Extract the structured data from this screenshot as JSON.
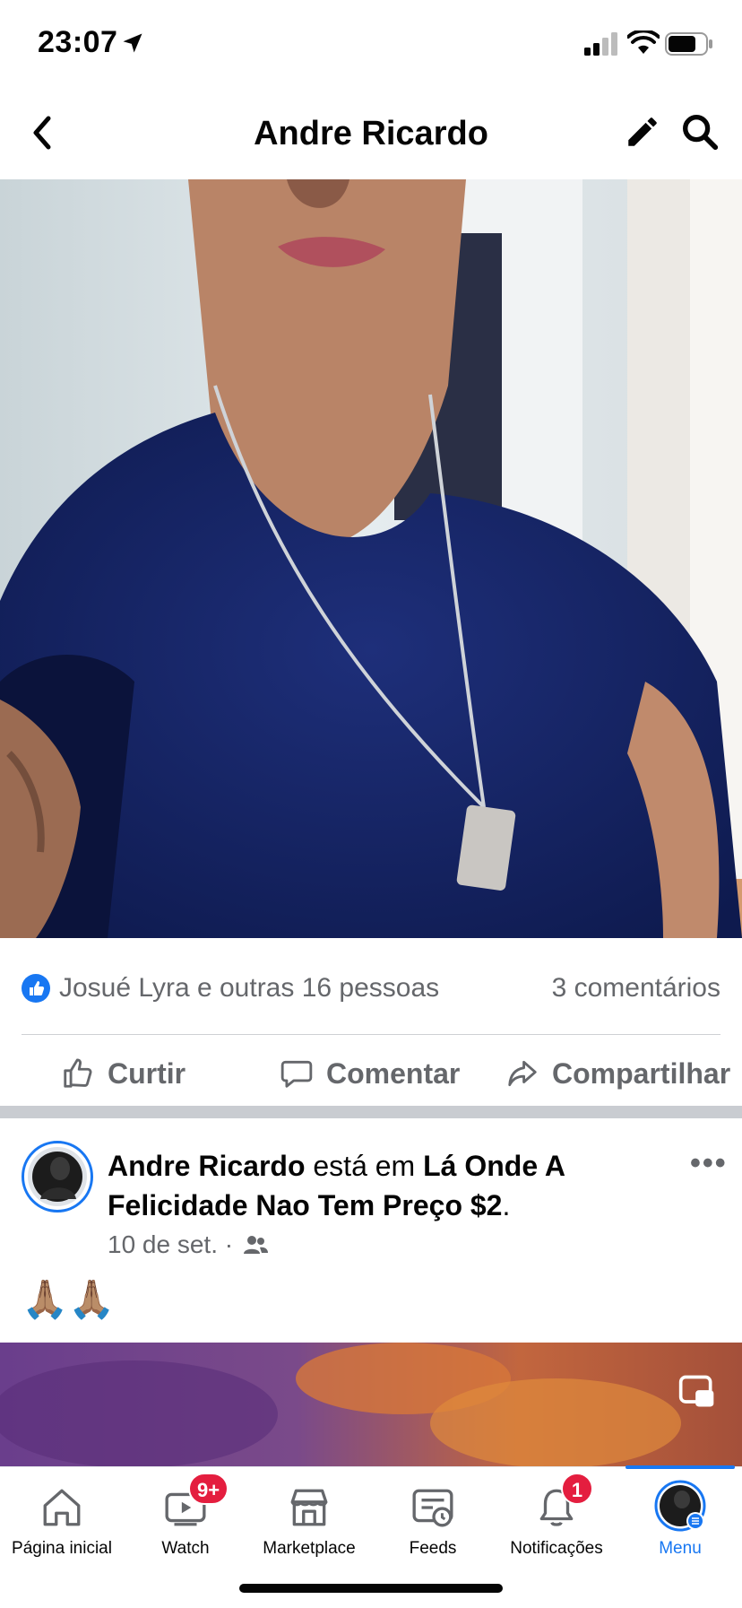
{
  "status_bar": {
    "time": "23:07"
  },
  "header": {
    "title": "Andre Ricardo"
  },
  "post1": {
    "reactions_text": "Josué Lyra e outras 16 pessoas",
    "comments_text": "3 comentários",
    "actions": {
      "like": "Curtir",
      "comment": "Comentar",
      "share": "Compartilhar"
    }
  },
  "post2": {
    "author": "Andre Ricardo",
    "connector": " está em ",
    "place": "Lá Onde A Felicidade Nao Tem Preço $2",
    "period": ".",
    "date": "10 de set. ·",
    "text": "🙏🏽🙏🏽"
  },
  "tabbar": {
    "items": [
      {
        "label": "Página inicial",
        "icon": "home-icon"
      },
      {
        "label": "Watch",
        "icon": "watch-icon",
        "badge": "9+"
      },
      {
        "label": "Marketplace",
        "icon": "marketplace-icon"
      },
      {
        "label": "Feeds",
        "icon": "feeds-icon"
      },
      {
        "label": "Notificações",
        "icon": "bell-icon",
        "badge": "1"
      },
      {
        "label": "Menu",
        "icon": "profile-avatar-icon"
      }
    ],
    "active_color": "#1877f2"
  },
  "colors": {
    "accent": "#1877f2",
    "badge": "#e41e3f",
    "secondary_text": "#65676b"
  }
}
